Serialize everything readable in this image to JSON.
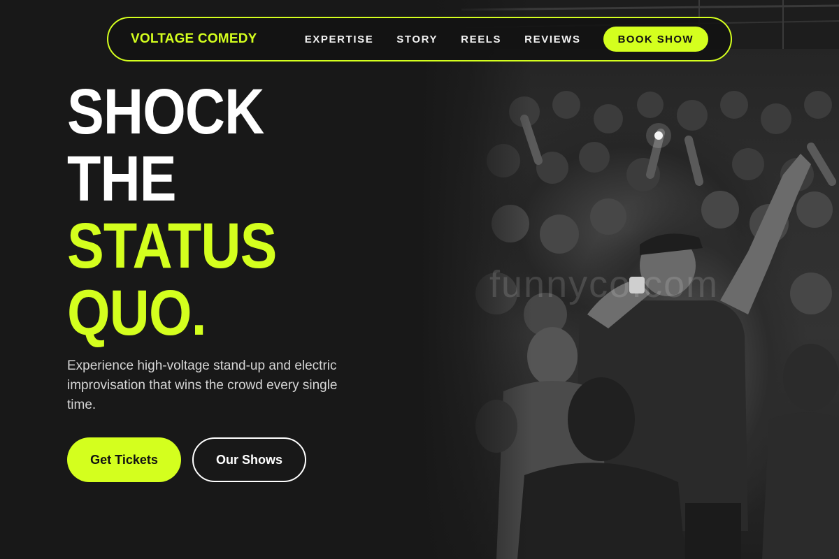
{
  "brand": {
    "name": "VOLTAGE COMEDY"
  },
  "nav": {
    "links": [
      "EXPERTISE",
      "STORY",
      "REELS",
      "REVIEWS"
    ],
    "cta": "BOOK SHOW"
  },
  "hero": {
    "headline": [
      "SHOCK",
      "THE",
      "STATUS",
      "QUO."
    ],
    "subtitle": "Experience high-voltage stand-up and electric improvisation that wins the crowd every single time.",
    "primary_button": "Get Tickets",
    "secondary_button": "Our Shows"
  },
  "photo": {
    "watermark": "funnyco.com",
    "icon": "stage-performer-crowd-photo"
  },
  "colors": {
    "accent": "#d4ff1e",
    "background": "#181818",
    "text": "#ffffff"
  }
}
